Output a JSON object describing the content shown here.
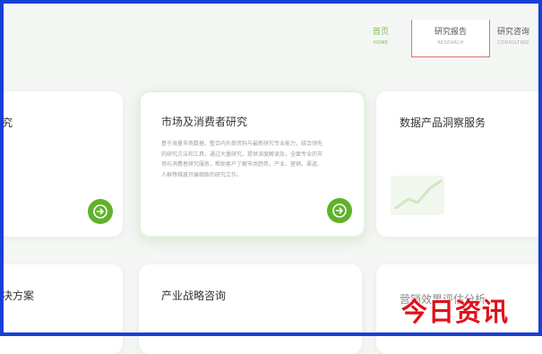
{
  "nav": {
    "home": {
      "zh": "首页",
      "en": "HOME"
    },
    "research": {
      "zh": "研究报告",
      "en": "RESEARCH"
    },
    "consulting": {
      "zh": "研究咨询",
      "en": "CONSULTING"
    }
  },
  "cards": {
    "left_top_title": "究",
    "market": {
      "title": "市场及消费者研究",
      "text": "基于海量市场数据，整合内外部资料与最新研究专业能力，结合领先的研究方法和工具，通过大量研究，提供深度解读及，全面专业的市场与消费者研究服务，帮助客户了解市场趋势，产业、营销、渠道、人群等维度开展细致的研究工作。"
    },
    "data_product": {
      "title": "数据产品洞察服务"
    },
    "left_bottom_title": "决方案",
    "industry": {
      "title": "产业战略咨询"
    },
    "right_bottom_title": "营销效果评估分析"
  },
  "watermark": "今日资讯",
  "colors": {
    "accent": "#5fb328",
    "frame": "#1a3fd8",
    "watermark": "#e0101a"
  }
}
